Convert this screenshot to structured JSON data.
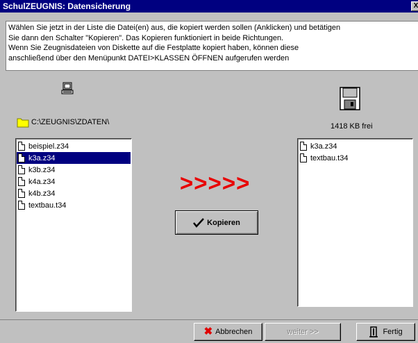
{
  "window": {
    "title": "SchulZEUGNIS: Datensicherung",
    "close_glyph": "X"
  },
  "instructions": {
    "lines": [
      "Wählen Sie jetzt in der Liste die Datei(en) aus, die kopiert werden sollen (Anklicken) und betätigen",
      "Sie dann den Schalter \"Kopieren\". Das Kopieren funktioniert in beide Richtungen.",
      "Wenn Sie Zeugnisdateien von Diskette auf die Festplatte kopiert haben, können diese",
      "anschließend über den Menüpunkt DATEI>KLASSEN ÖFFNEN aufgerufen werden"
    ]
  },
  "source": {
    "icon": "computer-icon",
    "folder_icon": "folder-icon",
    "path": "C:\\ZEUGNIS\\ZDATEN\\",
    "files": [
      "beispiel.z34",
      "k3a.z34",
      "k3b.z34",
      "k4a.z34",
      "k4b.z34",
      "textbau.t34"
    ],
    "selected_index": 1
  },
  "target": {
    "icon": "floppy-disk-icon",
    "free_space": "1418 KB frei",
    "files": [
      "k3a.z34",
      "textbau.t34"
    ]
  },
  "direction_arrows": ">>>>>",
  "buttons": {
    "copy": "Kopieren",
    "cancel": "Abbrechen",
    "next": "weiter >>",
    "done": "Fertig"
  },
  "colors": {
    "titlebar": "#000080",
    "window_bg": "#c0c0c0",
    "selection": "#000080",
    "arrows": "#e80000"
  }
}
